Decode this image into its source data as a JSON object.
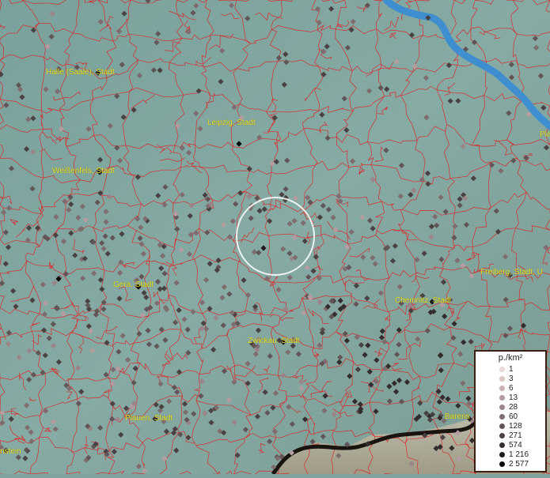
{
  "map": {
    "colors": {
      "background": "#7ea39f",
      "boundary": "#e02020",
      "river": "#3f8fd0",
      "border": "#1a1410",
      "label": "#e8e02a",
      "circle": "#ffffff"
    },
    "cities": [
      {
        "name": "Halle (Saale), Stadt"
      },
      {
        "name": "Leipzig, Stadt"
      },
      {
        "name": "Weißenfels, Stadt"
      },
      {
        "name": "Gera, Stadt"
      },
      {
        "name": "Chemnitz, Stadt"
      },
      {
        "name": "Freiberg, Stadt, U"
      },
      {
        "name": "Zwickau, Stadt"
      },
      {
        "name": "Plauen, Stadt"
      },
      {
        "name": "Barens"
      },
      {
        "name": "Pla"
      },
      {
        "name": "nstein"
      }
    ]
  },
  "legend": {
    "title": "p./km²",
    "items": [
      {
        "label": "1",
        "color": "#ead9d8"
      },
      {
        "label": "3",
        "color": "#dcc6c6"
      },
      {
        "label": "6",
        "color": "#cbb1b3"
      },
      {
        "label": "13",
        "color": "#b59ca0"
      },
      {
        "label": "28",
        "color": "#9b8487"
      },
      {
        "label": "60",
        "color": "#7e6c6f"
      },
      {
        "label": "128",
        "color": "#625557"
      },
      {
        "label": "271",
        "color": "#4a4142"
      },
      {
        "label": "574",
        "color": "#332c2d"
      },
      {
        "label": "1 216",
        "color": "#1f1a1b"
      },
      {
        "label": "2 577",
        "color": "#0a0808"
      }
    ]
  }
}
